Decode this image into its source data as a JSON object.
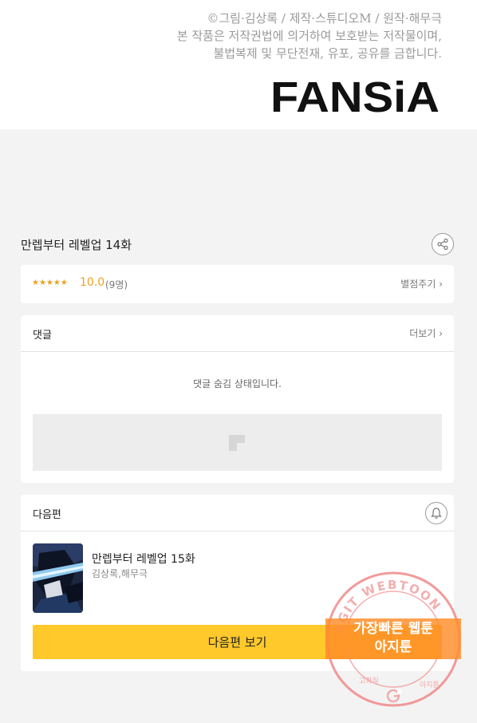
{
  "copyright": {
    "line1": "©그림·김상록 / 제작·스튜디오M / 원작·해무극",
    "line2": "본 작품은 저작권법에 의거하여 보호받는 저작물이며,",
    "line3": "불법복제 및 무단전재, 유포, 공유를 금합니다.",
    "logo_text": "FANSiA"
  },
  "episode": {
    "title": "만렙부터 레벨업 14화",
    "share_icon": "share-icon"
  },
  "rating": {
    "stars": "★★★★★",
    "score": "10.0",
    "votes": "(9명)",
    "rate_label": "별점주기 ›",
    "star_color": "#f0a01e"
  },
  "comments": {
    "title": "댓글",
    "more_label": "더보기 ›",
    "hidden_message": "댓글 숨김 상태입니다."
  },
  "next": {
    "section_title": "다음편",
    "bell_icon": "bell-icon",
    "episode_title": "만렙부터 레벨업 15화",
    "author": "김상록,해무극",
    "button_label": "다음편 보기",
    "button_color": "#ffc82b"
  },
  "watermark": {
    "ring_text": "AGIT WEBTOON",
    "line1": "가장빠른 웹툰",
    "line2": "아지툰",
    "bottom_left": "고화질",
    "bottom_right": "아지툰"
  }
}
